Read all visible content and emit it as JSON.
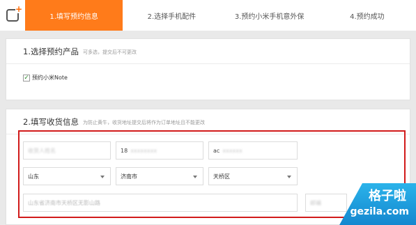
{
  "steps": [
    {
      "label": "1.填写预约信息"
    },
    {
      "label": "2.选择手机配件"
    },
    {
      "label": "3.预约小米手机意外保"
    },
    {
      "label": "4.预约成功"
    }
  ],
  "section1": {
    "title": "1.选择预约产品",
    "hint": "可多选，提交后不可更改",
    "product_label": "预约小米Note",
    "checked": true
  },
  "section2": {
    "title": "2.填写收货信息",
    "hint": "为防止黄牛，收货地址提交后将作为订单地址且不能更改",
    "name_value": "收货人姓名",
    "phone_value": "18",
    "phone_value_blurred": "xxxxxxxx",
    "email_value": "ac",
    "email_value_blurred": "xxxxxx",
    "province": "山东",
    "city": "济南市",
    "district": "天桥区",
    "address_value": "山东省济南市天桥区无影山路",
    "zip_value": "邮编"
  },
  "watermark": {
    "cn": "格子啦",
    "en": "gezila.com"
  },
  "colors": {
    "accent": "#ff7b1a",
    "highlight_border": "#d11a1a",
    "watermark": "#1a9ce0"
  }
}
